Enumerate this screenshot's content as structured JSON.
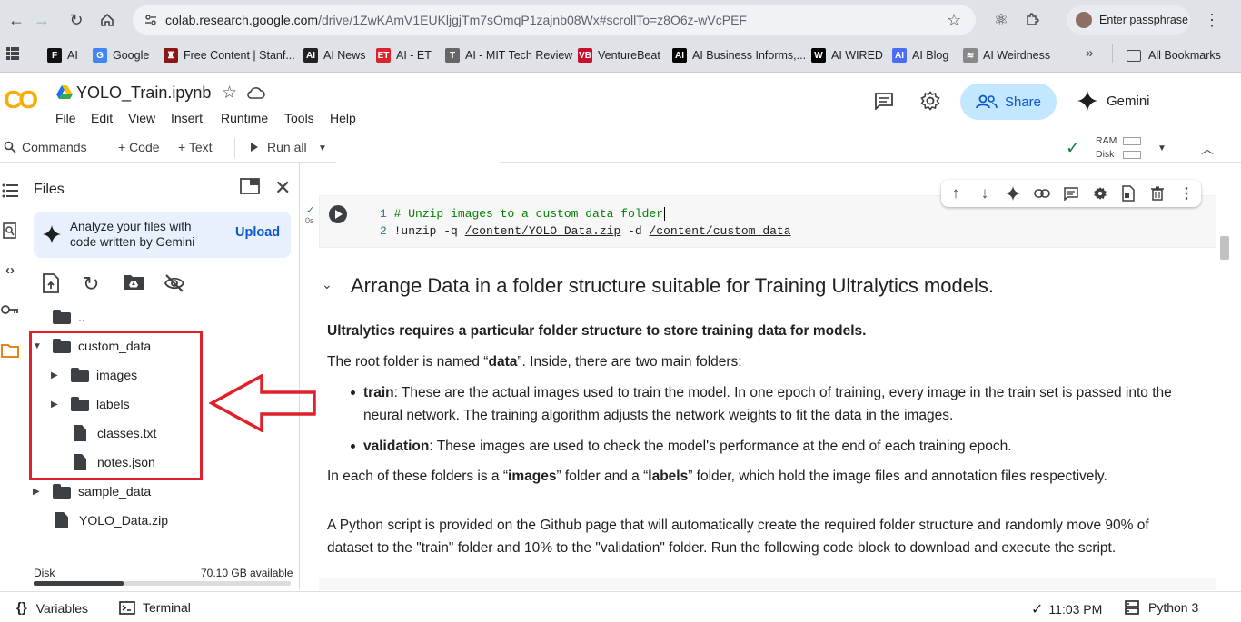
{
  "browser": {
    "url_host": "colab.research.google.com",
    "url_path": "/drive/1ZwKAmV1EUKljgjTm7sOmqP1zajnb08Wx#scrollTo=z8O6z-wVcPEF",
    "profile_label": "Enter passphrase",
    "bookmarks": [
      {
        "label": "AI",
        "icon_text": "F",
        "color": "#111111"
      },
      {
        "label": "Google",
        "icon_text": "G",
        "color": "#4285f4"
      },
      {
        "label": "Free Content | Stanf...",
        "icon_text": "♜",
        "color": "#8c1515"
      },
      {
        "label": "AI News",
        "icon_text": "AI",
        "color": "#222222"
      },
      {
        "label": "AI - ET",
        "icon_text": "ET",
        "color": "#d9232d"
      },
      {
        "label": "AI - MIT Tech Review",
        "icon_text": "T",
        "color": "#666666"
      },
      {
        "label": "VentureBeat",
        "icon_text": "VB",
        "color": "#c8102e"
      },
      {
        "label": "AI Business Informs,...",
        "icon_text": "AI",
        "color": "#000000"
      },
      {
        "label": "AI WIRED",
        "icon_text": "W",
        "color": "#000000"
      },
      {
        "label": "AI Blog",
        "icon_text": "AI",
        "color": "#4a6cf7"
      },
      {
        "label": "AI Weirdness",
        "icon_text": "≋",
        "color": "#888888"
      }
    ],
    "more": "»",
    "all_bookmarks": "All Bookmarks"
  },
  "header": {
    "logo": "CO",
    "notebook_title": "YOLO_Train.ipynb",
    "menu": [
      "File",
      "Edit",
      "View",
      "Insert",
      "Runtime",
      "Tools",
      "Help"
    ],
    "share_label": "Share",
    "gemini_label": "Gemini"
  },
  "toolbar": {
    "commands": "Commands",
    "add_code": "+ Code",
    "add_text": "+ Text",
    "run_all": "Run all",
    "ram": "RAM",
    "disk": "Disk"
  },
  "files": {
    "title": "Files",
    "gemini_card": "Analyze your files with code written by Gemini",
    "upload": "Upload",
    "tree": [
      {
        "name": "..",
        "type": "folder",
        "indent": 0,
        "caret": ""
      },
      {
        "name": "custom_data",
        "type": "folder",
        "indent": 0,
        "caret": "▼"
      },
      {
        "name": "images",
        "type": "folder",
        "indent": 1,
        "caret": "▶"
      },
      {
        "name": "labels",
        "type": "folder",
        "indent": 1,
        "caret": "▶"
      },
      {
        "name": "classes.txt",
        "type": "file",
        "indent": 1,
        "caret": ""
      },
      {
        "name": "notes.json",
        "type": "file",
        "indent": 1,
        "caret": ""
      },
      {
        "name": "sample_data",
        "type": "folder",
        "indent": 0,
        "caret": "▶"
      },
      {
        "name": "YOLO_Data.zip",
        "type": "file",
        "indent": 0,
        "caret": ""
      }
    ],
    "disk_label": "Disk",
    "disk_available": "70.10 GB available",
    "disk_used_fraction": 0.35
  },
  "cell": {
    "exec_time": "0s",
    "line1_num": "1",
    "line1": "# Unzip images to a custom data folder",
    "line2_num": "2",
    "line2_cmd": "!unzip -q ",
    "line2_src": "/content/YOLO_Data.zip",
    "line2_flag": " -d ",
    "line2_dst": "/content/custom_data"
  },
  "text": {
    "section_title": "Arrange Data in a folder structure suitable for Training Ultralytics models.",
    "p1": "Ultralytics requires a particular folder structure to store training data for models.",
    "p2_a": "The root folder is named “",
    "p2_b": "data",
    "p2_c": "”. Inside, there are two main folders:",
    "li1_b": "train",
    "li1_a": ": These are the actual images used to train the model. In one epoch of training, every image in the train set is passed into the",
    "li1_c": "neural network. The training algorithm adjusts the network weights to fit the data in the images.",
    "li2_b": "validation",
    "li2_a": ": These images are used to check the model's performance at the end of each training epoch.",
    "p3_a": "In each of these folders is a “",
    "p3_b": "images",
    "p3_c": "” folder and a “",
    "p3_d": "labels",
    "p3_e": "” folder, which hold the image files and annotation files respectively.",
    "p4_a": "A Python script is provided on the Github page that will automatically create the required folder structure and randomly move 90% of",
    "p4_b": "dataset to the \"train\" folder and 10% to the \"validation\" folder. Run the following code block to download and execute the script."
  },
  "status": {
    "variables": "Variables",
    "terminal": "Terminal",
    "time": "11:03 PM",
    "runtime": "Python 3"
  },
  "colors": {
    "annotation_red": "#e0202a",
    "accent_blue": "#0b57d0",
    "share_bg": "#c2e7ff"
  }
}
